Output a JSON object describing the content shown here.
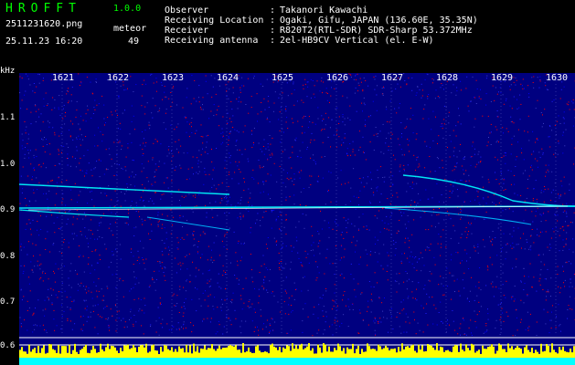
{
  "header": {
    "app_title": "HROFFT",
    "app_version": "1.0.0",
    "filename": "2511231620.png",
    "datetime": "25.11.23 16:20",
    "meteor_label": "meteor",
    "meteor_count": "49"
  },
  "info": [
    {
      "key": "Observer",
      "value": "Takanori Kawachi"
    },
    {
      "key": "Receiving Location",
      "value": "Ogaki, Gifu, JAPAN (136.60E, 35.35N)"
    },
    {
      "key": "Receiver",
      "value": "R820T2(RTL-SDR) SDR-Sharp 53.372MHz"
    },
    {
      "key": "Receiving antenna",
      "value": "2el-HB9CV Vertical (el. E-W)"
    }
  ],
  "info_separator": ":",
  "axis": {
    "unit": "kHz",
    "y_ticks": [
      "1.1",
      "1.0",
      "0.9",
      "0.8",
      "0.7",
      "0.6"
    ],
    "x_ticks": [
      "1621",
      "1622",
      "1623",
      "1624",
      "1625",
      "1626",
      "1627",
      "1628",
      "1629",
      "1630"
    ]
  },
  "colors": {
    "title": "#00ff00",
    "background": "#000080",
    "noise_red": "#ff0000",
    "trace": "#00ffff",
    "level_bars": "#ffff00",
    "level_base": "#00ffff"
  }
}
